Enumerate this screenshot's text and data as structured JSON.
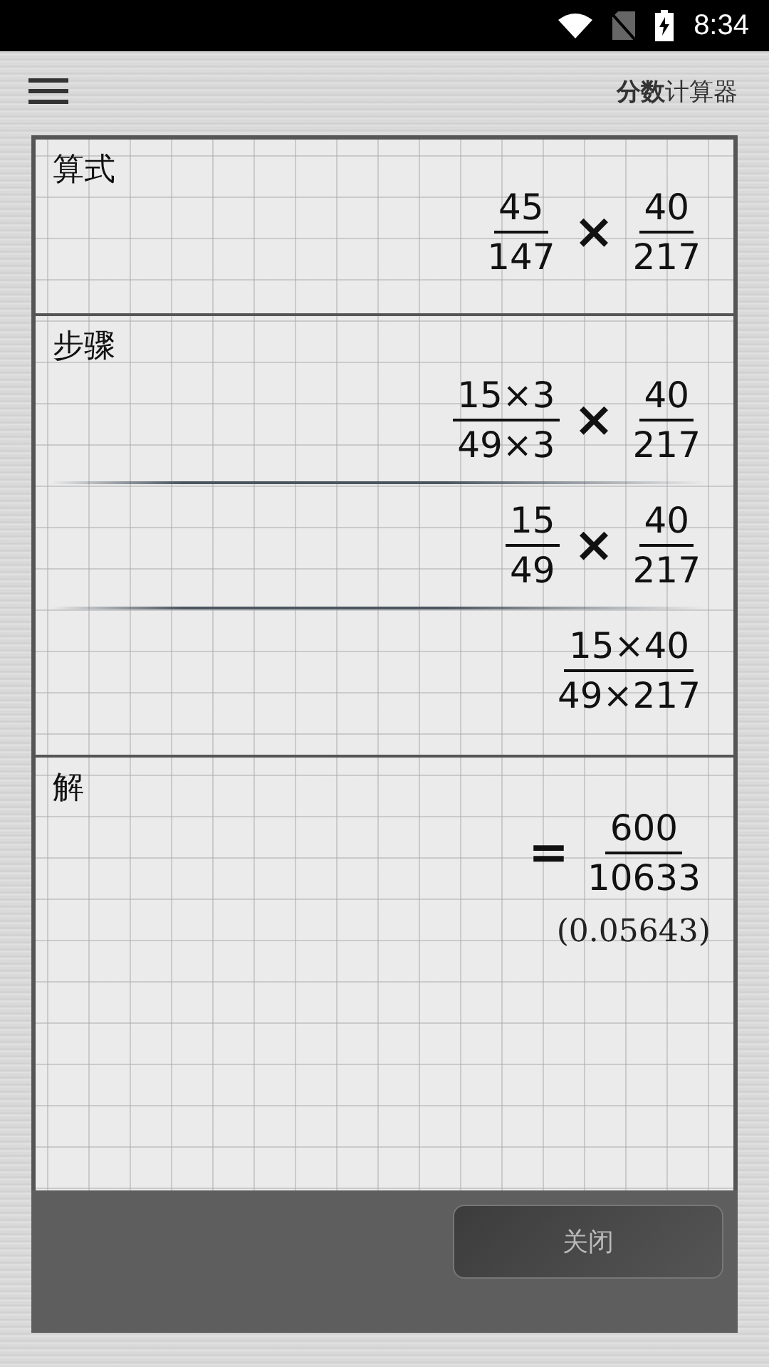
{
  "status_bar": {
    "time": "8:34"
  },
  "header": {
    "title": "**分数**计算器"
  },
  "expression": {
    "label": "算式",
    "terms": [
      {
        "kind": "fraction",
        "numerator": "45",
        "denominator": "147"
      },
      {
        "kind": "operator",
        "symbol": "×"
      },
      {
        "kind": "fraction",
        "numerator": "40",
        "denominator": "217"
      }
    ]
  },
  "steps": {
    "label": "步骤",
    "rows": [
      {
        "terms": [
          {
            "kind": "fraction",
            "numerator": "15×3",
            "denominator": "49×3"
          },
          {
            "kind": "operator",
            "symbol": "×"
          },
          {
            "kind": "fraction",
            "numerator": "40",
            "denominator": "217"
          }
        ]
      },
      {
        "terms": [
          {
            "kind": "fraction",
            "numerator": "15",
            "denominator": "49"
          },
          {
            "kind": "operator",
            "symbol": "×"
          },
          {
            "kind": "fraction",
            "numerator": "40",
            "denominator": "217"
          }
        ]
      },
      {
        "terms": [
          {
            "kind": "fraction",
            "numerator": "15×40",
            "denominator": "49×217"
          }
        ]
      }
    ]
  },
  "solution": {
    "label": "解",
    "terms": [
      {
        "kind": "operator",
        "symbol": "="
      },
      {
        "kind": "fraction",
        "numerator": "600",
        "denominator": "10633"
      }
    ],
    "decimal": "(0.05643)"
  },
  "button": {
    "label": "关闭"
  }
}
